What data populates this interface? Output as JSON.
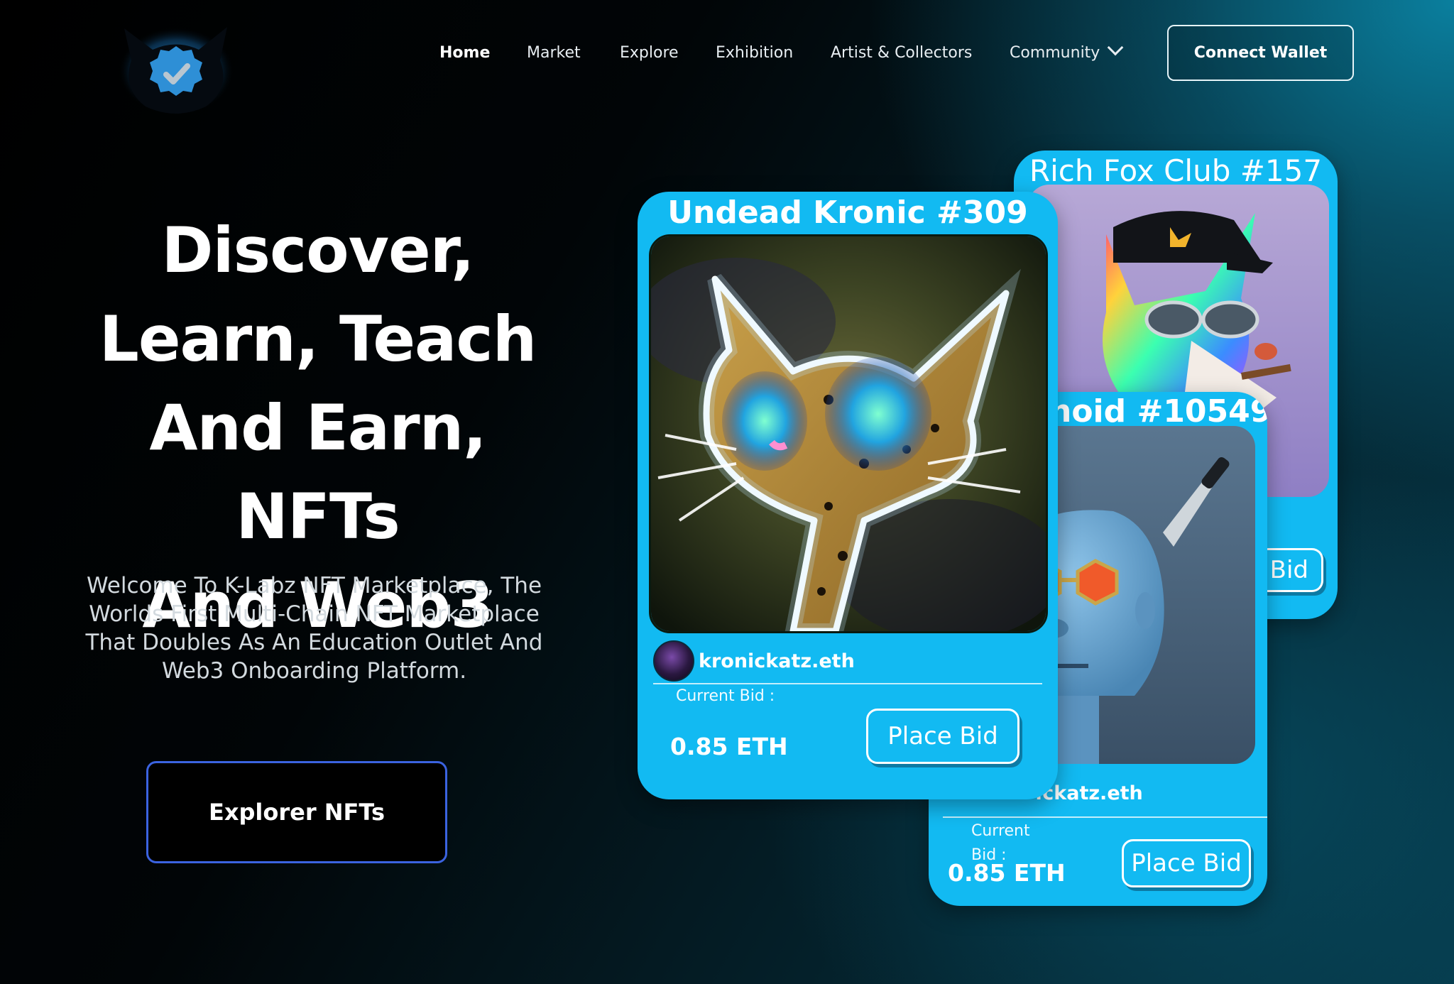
{
  "nav": {
    "items": [
      {
        "label": "Home",
        "active": true
      },
      {
        "label": "Market"
      },
      {
        "label": "Explore"
      },
      {
        "label": "Exhibition"
      },
      {
        "label": "Artist & Collectors"
      },
      {
        "label": "Community",
        "has_dropdown": true
      }
    ],
    "connect_wallet": "Connect Wallet"
  },
  "hero": {
    "title_lines": [
      "Discover,",
      "Learn, Teach",
      "And Earn, NFTs",
      "And Web3"
    ],
    "subtitle_lines": [
      "Welcome To K-Labz NFT Marketplace, The",
      "Worlds First Multi-Chain NFT Marketplace",
      "That Doubles As An Education Outlet And",
      "Web3 Onboarding Platform."
    ],
    "cta": "Explorer NFTs"
  },
  "cards": {
    "back": {
      "title": "Rich Fox Club #157",
      "place_bid_partial": "Bid"
    },
    "middle": {
      "title_partial": "noid #10549",
      "owner_partial": ".ckatz.eth",
      "bid_label_line1": "Current",
      "bid_label_line2": "Bid :",
      "bid_value": "0.85 ETH",
      "place_bid": "Place Bid"
    },
    "front": {
      "title": "Undead Kronic #309",
      "owner": "kronickatz.eth",
      "bid_label": "Current Bid :",
      "bid_value": "0.85 ETH",
      "place_bid": "Place Bid"
    }
  },
  "colors": {
    "card": "#12baf2",
    "cta_border": "#3b63e0",
    "background_dark": "#000000",
    "background_teal": "#0a7f9e"
  },
  "icons": [
    "verified-badge-cat-logo",
    "chevron-down-icon"
  ]
}
